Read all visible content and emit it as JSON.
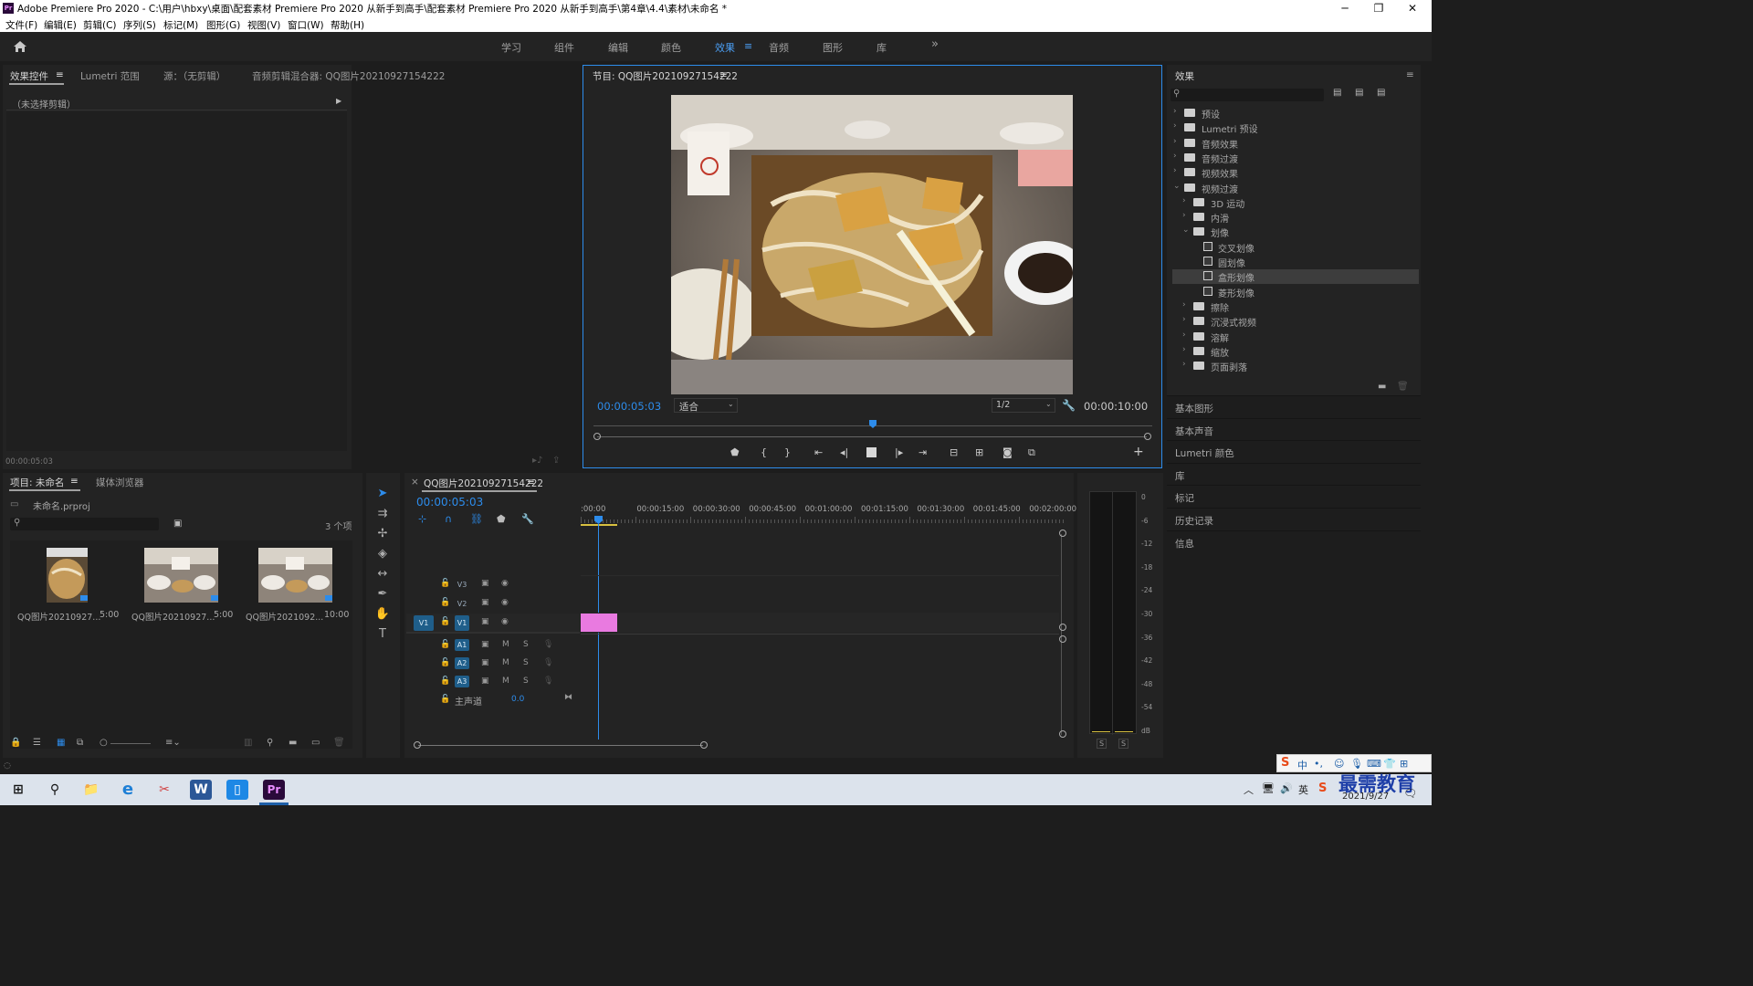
{
  "window": {
    "title": "Adobe Premiere Pro 2020 - C:\\用户\\hbxy\\桌面\\配套素材 Premiere Pro 2020 从新手到高手\\配套素材 Premiere Pro 2020 从新手到高手\\第4章\\4.4\\素材\\未命名 *",
    "app_logo": "Pr",
    "controls": {
      "minimize": "─",
      "restore": "❐",
      "close": "✕"
    }
  },
  "menu": [
    "文件(F)",
    "编辑(E)",
    "剪辑(C)",
    "序列(S)",
    "标记(M)",
    "图形(G)",
    "视图(V)",
    "窗口(W)",
    "帮助(H)"
  ],
  "workspaces": {
    "tabs": [
      "学习",
      "组件",
      "编辑",
      "颜色",
      "效果",
      "音频",
      "图形",
      "库"
    ],
    "active": "效果",
    "active_menu_icon": "≡",
    "more": "»"
  },
  "source_panel": {
    "tabs": [
      "效果控件",
      "Lumetri 范围",
      "源：（无剪辑）",
      "音频剪辑混合器: QQ图片20210927154222"
    ],
    "menu_icon": "≡",
    "no_clip": "（未选择剪辑）",
    "timecode": "00:00:05:03"
  },
  "program_monitor": {
    "title": "节目: QQ图片20210927154222",
    "menu_icon": "≡",
    "timecode_current": "00:00:05:03",
    "fit": "适合",
    "resolution": "1/2",
    "timecode_total": "00:00:10:00",
    "playhead_fraction": 0.5
  },
  "effects_panel": {
    "title": "效果",
    "menu_icon": "≡",
    "search_placeholder": "",
    "tree": [
      {
        "label": "预设",
        "level": 0,
        "open": false,
        "type": "star-folder"
      },
      {
        "label": "Lumetri 预设",
        "level": 0,
        "open": false,
        "type": "star-folder"
      },
      {
        "label": "音频效果",
        "level": 0,
        "open": false,
        "type": "folder"
      },
      {
        "label": "音频过渡",
        "level": 0,
        "open": false,
        "type": "folder"
      },
      {
        "label": "视频效果",
        "level": 0,
        "open": false,
        "type": "folder"
      },
      {
        "label": "视频过渡",
        "level": 0,
        "open": true,
        "type": "folder"
      },
      {
        "label": "3D 运动",
        "level": 1,
        "open": false,
        "type": "folder"
      },
      {
        "label": "内滑",
        "level": 1,
        "open": false,
        "type": "folder"
      },
      {
        "label": "划像",
        "level": 1,
        "open": true,
        "type": "folder"
      },
      {
        "label": "交叉划像",
        "level": 2,
        "type": "effect"
      },
      {
        "label": "圆划像",
        "level": 2,
        "type": "effect"
      },
      {
        "label": "盒形划像",
        "level": 2,
        "type": "effect",
        "selected": true
      },
      {
        "label": "菱形划像",
        "level": 2,
        "type": "effect"
      },
      {
        "label": "擦除",
        "level": 1,
        "open": false,
        "type": "folder"
      },
      {
        "label": "沉浸式视频",
        "level": 1,
        "open": false,
        "type": "folder"
      },
      {
        "label": "溶解",
        "level": 1,
        "open": false,
        "type": "folder"
      },
      {
        "label": "缩放",
        "level": 1,
        "open": false,
        "type": "folder"
      },
      {
        "label": "页面剥落",
        "level": 1,
        "open": false,
        "type": "folder"
      }
    ],
    "side_panels": [
      "基本图形",
      "基本声音",
      "Lumetri 颜色",
      "库",
      "标记",
      "历史记录",
      "信息"
    ]
  },
  "project_panel": {
    "tabs": [
      "项目: 未命名",
      "媒体浏览器"
    ],
    "menu_icon": "≡",
    "project_file": "未命名.prproj",
    "item_count": "3 个项",
    "items": [
      {
        "name": "QQ图片20210927...",
        "duration": "5:00"
      },
      {
        "name": "QQ图片20210927...",
        "duration": "5:00"
      },
      {
        "name": "QQ图片2021092...",
        "duration": "10:00"
      }
    ]
  },
  "timeline": {
    "sequence_name": "QQ图片20210927154222",
    "close_icon": "×",
    "menu_icon": "≡",
    "timecode": "00:00:05:03",
    "ruler": [
      ":00:00",
      "00:00:15:00",
      "00:00:30:00",
      "00:00:45:00",
      "00:01:00:00",
      "00:01:15:00",
      "00:01:30:00",
      "00:01:45:00",
      "00:02:00:00"
    ],
    "video_tracks": [
      "V3",
      "V2",
      "V1"
    ],
    "audio_tracks": [
      "A1",
      "A2",
      "A3"
    ],
    "source_patch": "V1",
    "mute": "M",
    "solo": "S",
    "master_label": "主声道",
    "master_value": "0.0"
  },
  "audio_meter": {
    "scale": [
      "0",
      "-6",
      "-12",
      "-18",
      "-24",
      "-30",
      "-36",
      "-42",
      "-48",
      "-54",
      "dB"
    ],
    "solo_buttons": [
      "S",
      "S"
    ]
  },
  "taskbar": {
    "ime": [
      "S",
      "中",
      "•,",
      "☺",
      "🎙",
      "⌨",
      "👕",
      "⊞"
    ],
    "date": "2021/9/27",
    "watermark": "最需教育",
    "apps": [
      "⊞",
      "⚲",
      "📁",
      "e",
      "✂",
      "W",
      "▯",
      "Pr"
    ]
  },
  "colors": {
    "accent": "#2d8ceb",
    "timecode": "#2d8ceb",
    "clip": "#e97ae0",
    "background": "#232323"
  }
}
